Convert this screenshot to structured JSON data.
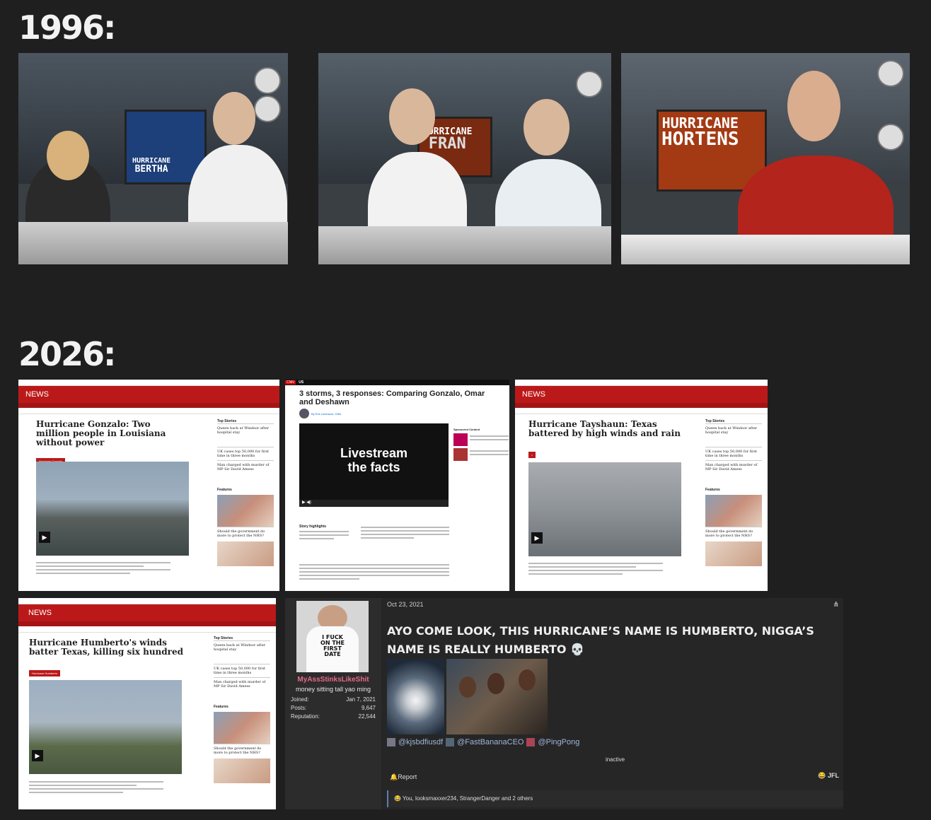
{
  "heading_1996": "1996:",
  "heading_2026": "2026:",
  "stills": [
    {
      "sign_line1": "HURRICANE",
      "sign_line2": "BERTHA"
    },
    {
      "sign_line1": "HURRICANE",
      "sign_line2": "FRAN"
    },
    {
      "sign_line1": "HURRICANE",
      "sign_line2": "HORTENS"
    }
  ],
  "bbc1": {
    "brand": "NEWS",
    "title": "Hurricane Gonzalo: Two million people in Louisiana without power",
    "tag": "Hurricane Gonzalo",
    "top_stories": "Top Stories",
    "features": "Features",
    "story1": "Queen back at Windsor after hospital stay",
    "story2": "UK cases top 50,000 for first time in three months",
    "story3": "Man charged with murder of MP Sir David Amess",
    "feature1": "Should the government do more to protect the NHS?"
  },
  "cnn": {
    "logo": "CNN",
    "section": "US",
    "title": "3 storms, 3 responses: Comparing Gonzalo, Omar and Deshawn",
    "byline": "By Eric Levenson, CNN",
    "video_text_1": "Livestream",
    "video_text_2": "the facts",
    "sponsored": "Sponsored Content",
    "highlights": "Story highlights"
  },
  "bbc2": {
    "brand": "NEWS",
    "title": "Hurricane Tayshaun: Texas battered by high winds and rain",
    "top_stories": "Top Stories",
    "features": "Features",
    "story1": "Queen back at Windsor after hospital stay",
    "story2": "UK cases top 50,000 for first time in three months",
    "story3": "Man charged with murder of MP Sir David Amess",
    "feature1": "Should the government do more to protect the NHS?"
  },
  "bbc3": {
    "brand": "NEWS",
    "title": "Hurricane Humberto's winds batter Texas, killing six hundred",
    "tag": "Hurricane Humberto",
    "top_stories": "Top Stories",
    "features": "Features",
    "story1": "Queen back at Windsor after hospital stay",
    "story2": "UK cases top 50,000 for first time in three months",
    "story3": "Man charged with murder of MP Sir David Amess",
    "feature1": "Should the government do more to protect the NHS?"
  },
  "post": {
    "date": "Oct 23, 2021",
    "avatar_shirt_text": "I FUCK ON THE FIRST DATE",
    "username": "MyAssStinksLikeShit",
    "user_title": "money sitting tall yao ming",
    "joined_label": "Joined:",
    "joined_value": "Jan 7, 2021",
    "posts_label": "Posts:",
    "posts_value": "9,647",
    "rep_label": "Reputation:",
    "rep_value": "22,544",
    "content": "AYO COME LOOK, THIS HURRICANE’S NAME IS HUMBERTO, NIGGA’S NAME IS REALLY HUMBERTO 💀",
    "mention1": "@kjsbdfiusdf",
    "mention2": "@FastBananaCEO",
    "mention3": "@PingPong",
    "status": "inactive",
    "report": "Report",
    "reaction": "JFL",
    "reactors": "You, looksmaxxer234, StrangerDanger and 2 others"
  }
}
